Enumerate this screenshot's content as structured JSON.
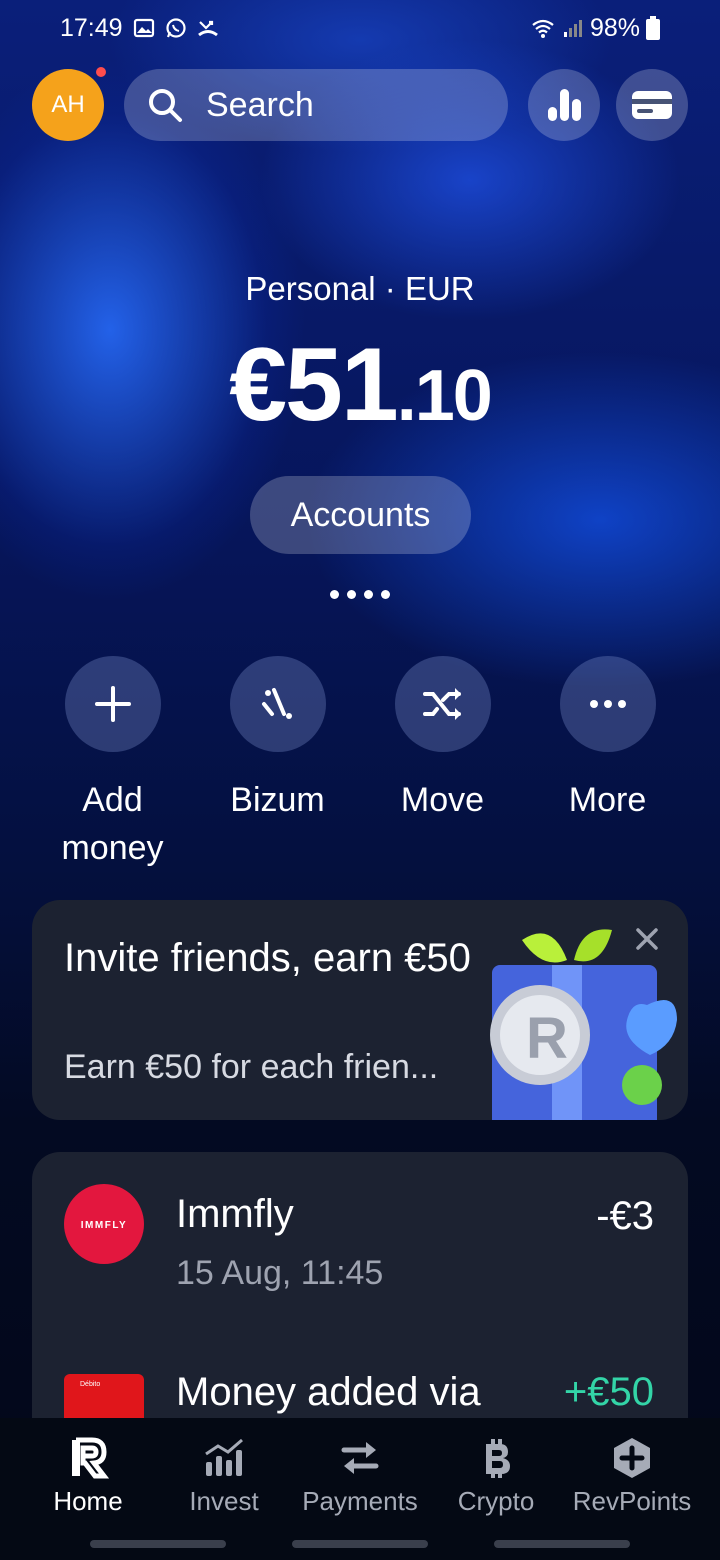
{
  "status_bar": {
    "time": "17:49",
    "battery": "98%"
  },
  "header": {
    "avatar_initials": "AH",
    "search_placeholder": "Search"
  },
  "balance": {
    "account_label": "Personal · EUR",
    "amount_main": "€51",
    "amount_cents": ".10",
    "accounts_button": "Accounts"
  },
  "actions": [
    {
      "label_line1": "Add",
      "label_line2": "money",
      "icon": "plus-icon"
    },
    {
      "label_line1": "Bizum",
      "label_line2": "",
      "icon": "bizum-icon"
    },
    {
      "label_line1": "Move",
      "label_line2": "",
      "icon": "shuffle-icon"
    },
    {
      "label_line1": "More",
      "label_line2": "",
      "icon": "more-dots-icon"
    }
  ],
  "invite_card": {
    "title": "Invite friends, earn €50",
    "description": "Earn €50 for each frien..."
  },
  "transactions": [
    {
      "name": "Immfly",
      "time": "15 Aug, 11:45",
      "amount": "-€3",
      "logo_text": "IMMFLY"
    },
    {
      "name": "Money added via",
      "time": "",
      "amount": "+€50",
      "logo_text": "Débito"
    }
  ],
  "bottom_nav": [
    {
      "label": "Home",
      "icon": "revolut-r-icon",
      "active": true
    },
    {
      "label": "Invest",
      "icon": "chart-bars-icon",
      "active": false
    },
    {
      "label": "Payments",
      "icon": "transfer-arrows-icon",
      "active": false
    },
    {
      "label": "Crypto",
      "icon": "bitcoin-icon",
      "active": false
    },
    {
      "label": "RevPoints",
      "icon": "revpoints-icon",
      "active": false
    }
  ],
  "colors": {
    "avatar_bg": "#f5a21b",
    "positive_amount": "#33d4a7",
    "card_bg": "#1c2231",
    "immfly_red": "#e3173e"
  }
}
